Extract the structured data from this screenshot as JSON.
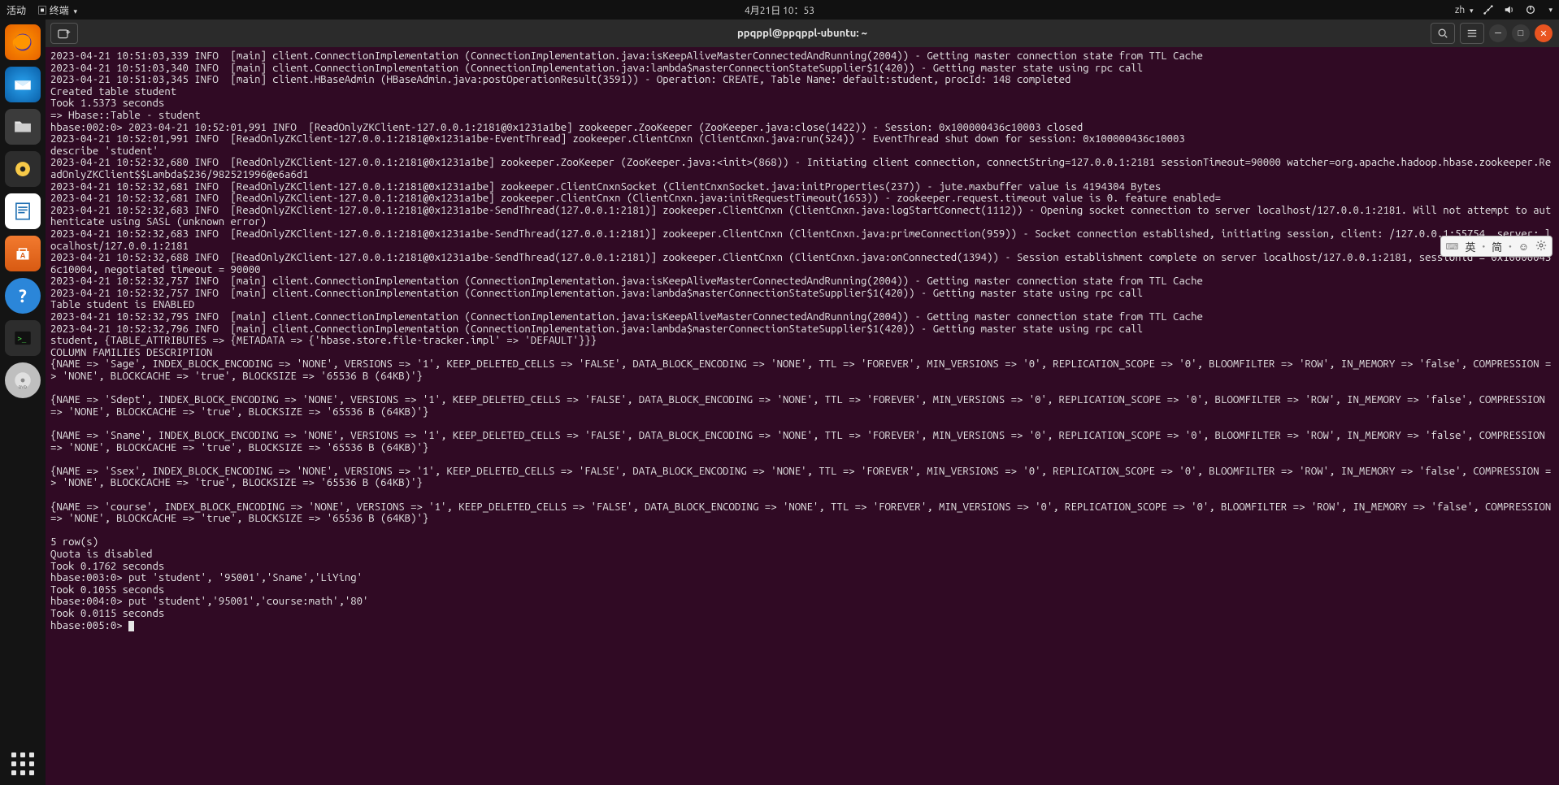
{
  "topbar": {
    "activities": "活动",
    "app_menu": "终端",
    "datetime": "4月21日 10：53",
    "lang": "zh"
  },
  "dock": {
    "items": [
      {
        "name": "firefox"
      },
      {
        "name": "thunderbird"
      },
      {
        "name": "files"
      },
      {
        "name": "rhythmbox"
      },
      {
        "name": "writer"
      },
      {
        "name": "software"
      },
      {
        "name": "help"
      },
      {
        "name": "terminal"
      },
      {
        "name": "disk"
      }
    ]
  },
  "window": {
    "title": "ppqppl@ppqppl-ubuntu: ~"
  },
  "ime": {
    "a": "英",
    "b": "简"
  },
  "terminal_lines": [
    "2023-04-21 10:51:03,339 INFO  [main] client.ConnectionImplementation (ConnectionImplementation.java:isKeepAliveMasterConnectedAndRunning(2004)) - Getting master connection state from TTL Cache",
    "2023-04-21 10:51:03,340 INFO  [main] client.ConnectionImplementation (ConnectionImplementation.java:lambda$masterConnectionStateSupplier$1(420)) - Getting master state using rpc call",
    "2023-04-21 10:51:03,345 INFO  [main] client.HBaseAdmin (HBaseAdmin.java:postOperationResult(3591)) - Operation: CREATE, Table Name: default:student, procId: 148 completed",
    "Created table student",
    "Took 1.5373 seconds",
    "=> Hbase::Table - student",
    "hbase:002:0> 2023-04-21 10:52:01,991 INFO  [ReadOnlyZKClient-127.0.0.1:2181@0x1231a1be] zookeeper.ZooKeeper (ZooKeeper.java:close(1422)) - Session: 0x100000436c10003 closed",
    "2023-04-21 10:52:01,991 INFO  [ReadOnlyZKClient-127.0.0.1:2181@0x1231a1be-EventThread] zookeeper.ClientCnxn (ClientCnxn.java:run(524)) - EventThread shut down for session: 0x100000436c10003",
    "describe 'student'",
    "2023-04-21 10:52:32,680 INFO  [ReadOnlyZKClient-127.0.0.1:2181@0x1231a1be] zookeeper.ZooKeeper (ZooKeeper.java:<init>(868)) - Initiating client connection, connectString=127.0.0.1:2181 sessionTimeout=90000 watcher=org.apache.hadoop.hbase.zookeeper.ReadOnlyZKClient$$Lambda$236/982521996@e6a6d1",
    "2023-04-21 10:52:32,681 INFO  [ReadOnlyZKClient-127.0.0.1:2181@0x1231a1be] zookeeper.ClientCnxnSocket (ClientCnxnSocket.java:initProperties(237)) - jute.maxbuffer value is 4194304 Bytes",
    "2023-04-21 10:52:32,681 INFO  [ReadOnlyZKClient-127.0.0.1:2181@0x1231a1be] zookeeper.ClientCnxn (ClientCnxn.java:initRequestTimeout(1653)) - zookeeper.request.timeout value is 0. feature enabled=",
    "2023-04-21 10:52:32,683 INFO  [ReadOnlyZKClient-127.0.0.1:2181@0x1231a1be-SendThread(127.0.0.1:2181)] zookeeper.ClientCnxn (ClientCnxn.java:logStartConnect(1112)) - Opening socket connection to server localhost/127.0.0.1:2181. Will not attempt to authenticate using SASL (unknown error)",
    "2023-04-21 10:52:32,683 INFO  [ReadOnlyZKClient-127.0.0.1:2181@0x1231a1be-SendThread(127.0.0.1:2181)] zookeeper.ClientCnxn (ClientCnxn.java:primeConnection(959)) - Socket connection established, initiating session, client: /127.0.0.1:55754, server: localhost/127.0.0.1:2181",
    "2023-04-21 10:52:32,688 INFO  [ReadOnlyZKClient-127.0.0.1:2181@0x1231a1be-SendThread(127.0.0.1:2181)] zookeeper.ClientCnxn (ClientCnxn.java:onConnected(1394)) - Session establishment complete on server localhost/127.0.0.1:2181, sessionid = 0x100000436c10004, negotiated timeout = 90000",
    "2023-04-21 10:52:32,757 INFO  [main] client.ConnectionImplementation (ConnectionImplementation.java:isKeepAliveMasterConnectedAndRunning(2004)) - Getting master connection state from TTL Cache",
    "2023-04-21 10:52:32,757 INFO  [main] client.ConnectionImplementation (ConnectionImplementation.java:lambda$masterConnectionStateSupplier$1(420)) - Getting master state using rpc call",
    "Table student is ENABLED",
    "2023-04-21 10:52:32,795 INFO  [main] client.ConnectionImplementation (ConnectionImplementation.java:isKeepAliveMasterConnectedAndRunning(2004)) - Getting master connection state from TTL Cache",
    "2023-04-21 10:52:32,796 INFO  [main] client.ConnectionImplementation (ConnectionImplementation.java:lambda$masterConnectionStateSupplier$1(420)) - Getting master state using rpc call",
    "student, {TABLE_ATTRIBUTES => {METADATA => {'hbase.store.file-tracker.impl' => 'DEFAULT'}}}",
    "COLUMN FAMILIES DESCRIPTION",
    "{NAME => 'Sage', INDEX_BLOCK_ENCODING => 'NONE', VERSIONS => '1', KEEP_DELETED_CELLS => 'FALSE', DATA_BLOCK_ENCODING => 'NONE', TTL => 'FOREVER', MIN_VERSIONS => '0', REPLICATION_SCOPE => '0', BLOOMFILTER => 'ROW', IN_MEMORY => 'false', COMPRESSION => 'NONE', BLOCKCACHE => 'true', BLOCKSIZE => '65536 B (64KB)'}",
    "",
    "{NAME => 'Sdept', INDEX_BLOCK_ENCODING => 'NONE', VERSIONS => '1', KEEP_DELETED_CELLS => 'FALSE', DATA_BLOCK_ENCODING => 'NONE', TTL => 'FOREVER', MIN_VERSIONS => '0', REPLICATION_SCOPE => '0', BLOOMFILTER => 'ROW', IN_MEMORY => 'false', COMPRESSION => 'NONE', BLOCKCACHE => 'true', BLOCKSIZE => '65536 B (64KB)'}",
    "",
    "{NAME => 'Sname', INDEX_BLOCK_ENCODING => 'NONE', VERSIONS => '1', KEEP_DELETED_CELLS => 'FALSE', DATA_BLOCK_ENCODING => 'NONE', TTL => 'FOREVER', MIN_VERSIONS => '0', REPLICATION_SCOPE => '0', BLOOMFILTER => 'ROW', IN_MEMORY => 'false', COMPRESSION => 'NONE', BLOCKCACHE => 'true', BLOCKSIZE => '65536 B (64KB)'}",
    "",
    "{NAME => 'Ssex', INDEX_BLOCK_ENCODING => 'NONE', VERSIONS => '1', KEEP_DELETED_CELLS => 'FALSE', DATA_BLOCK_ENCODING => 'NONE', TTL => 'FOREVER', MIN_VERSIONS => '0', REPLICATION_SCOPE => '0', BLOOMFILTER => 'ROW', IN_MEMORY => 'false', COMPRESSION => 'NONE', BLOCKCACHE => 'true', BLOCKSIZE => '65536 B (64KB)'}",
    "",
    "{NAME => 'course', INDEX_BLOCK_ENCODING => 'NONE', VERSIONS => '1', KEEP_DELETED_CELLS => 'FALSE', DATA_BLOCK_ENCODING => 'NONE', TTL => 'FOREVER', MIN_VERSIONS => '0', REPLICATION_SCOPE => '0', BLOOMFILTER => 'ROW', IN_MEMORY => 'false', COMPRESSION => 'NONE', BLOCKCACHE => 'true', BLOCKSIZE => '65536 B (64KB)'}",
    "",
    "5 row(s)",
    "Quota is disabled",
    "Took 0.1762 seconds",
    "hbase:003:0> put 'student', '95001','Sname','LiYing'",
    "Took 0.1055 seconds",
    "hbase:004:0> put 'student','95001','course:math','80'",
    "Took 0.0115 seconds"
  ],
  "prompt": "hbase:005:0> "
}
